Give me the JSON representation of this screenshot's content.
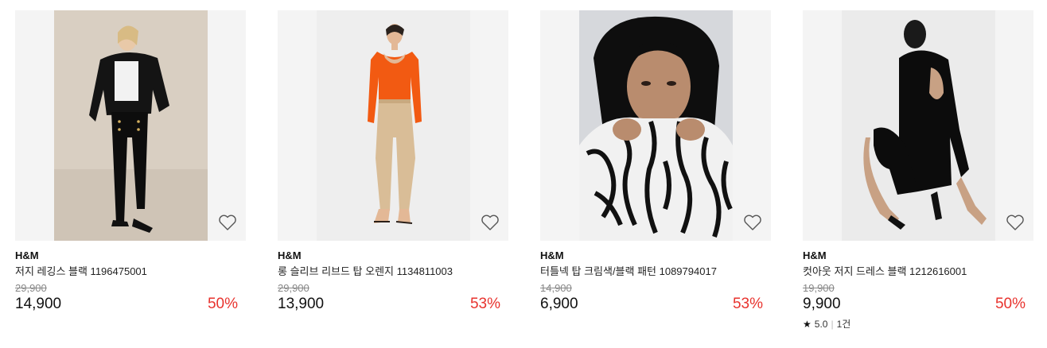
{
  "products": [
    {
      "brand": "H&M",
      "name": "저지 레깅스 블랙 1196475001",
      "original_price": "29,900",
      "price": "14,900",
      "discount": "50%",
      "wishlist_icon": "heart-outline-icon"
    },
    {
      "brand": "H&M",
      "name": "롱 슬리브 리브드 탑 오렌지 1134811003",
      "original_price": "29,900",
      "price": "13,900",
      "discount": "53%",
      "wishlist_icon": "heart-outline-icon"
    },
    {
      "brand": "H&M",
      "name": "터틀넥 탑 크림색/블랙 패턴 1089794017",
      "original_price": "14,900",
      "price": "6,900",
      "discount": "53%",
      "wishlist_icon": "heart-outline-icon"
    },
    {
      "brand": "H&M",
      "name": "컷아웃 저지 드레스 블랙 1212616001",
      "original_price": "19,900",
      "price": "9,900",
      "discount": "50%",
      "wishlist_icon": "heart-outline-icon",
      "rating": {
        "score": "5.0",
        "count": "1건",
        "icon": "star-icon"
      }
    }
  ],
  "colors": {
    "discount": "#e8332e",
    "image_bg": "#f4f4f4",
    "strikethrough": "#888888"
  }
}
